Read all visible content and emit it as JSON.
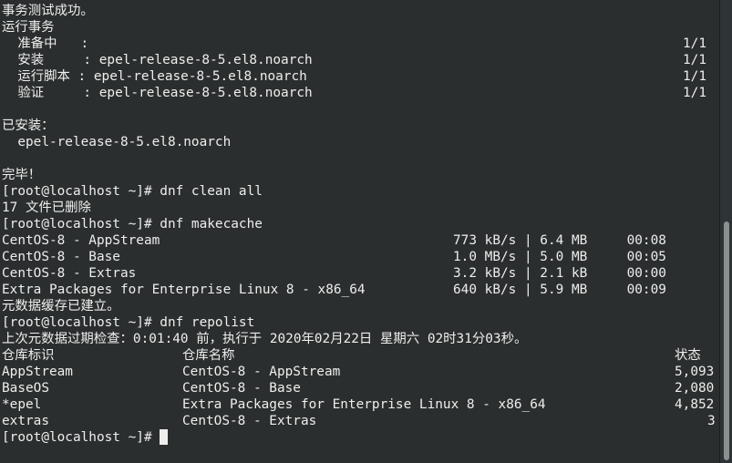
{
  "lines": [
    {
      "segments": [
        {
          "text": "事务测试成功。",
          "col": 0
        }
      ]
    },
    {
      "segments": [
        {
          "text": "运行事务",
          "col": 0
        }
      ]
    },
    {
      "segments": [
        {
          "text": "  准备中   :",
          "col": 0
        },
        {
          "text": "1/1",
          "col": 83
        }
      ]
    },
    {
      "segments": [
        {
          "text": "  安装     : epel-release-8-5.el8.noarch",
          "col": 0
        },
        {
          "text": "1/1",
          "col": 83
        }
      ]
    },
    {
      "segments": [
        {
          "text": "  运行脚本 : epel-release-8-5.el8.noarch",
          "col": 0
        },
        {
          "text": "1/1",
          "col": 83
        }
      ]
    },
    {
      "segments": [
        {
          "text": "  验证     : epel-release-8-5.el8.noarch",
          "col": 0
        },
        {
          "text": "1/1",
          "col": 83
        }
      ]
    },
    {
      "segments": []
    },
    {
      "segments": [
        {
          "text": "已安装：",
          "col": 0
        }
      ]
    },
    {
      "segments": [
        {
          "text": "  epel-release-8-5.el8.noarch",
          "col": 0
        }
      ]
    },
    {
      "segments": []
    },
    {
      "segments": [
        {
          "text": "完毕！",
          "col": 0
        }
      ]
    },
    {
      "segments": [
        {
          "text": "[root@localhost ~]# dnf clean all",
          "col": 0
        }
      ]
    },
    {
      "segments": [
        {
          "text": "17 文件已删除",
          "col": 0
        }
      ]
    },
    {
      "segments": [
        {
          "text": "[root@localhost ~]# dnf makecache",
          "col": 0
        }
      ]
    },
    {
      "segments": [
        {
          "text": "CentOS-8 - AppStream",
          "col": 0
        },
        {
          "text": "773 kB/s | 6.4 MB     00:08",
          "col": 55
        }
      ]
    },
    {
      "segments": [
        {
          "text": "CentOS-8 - Base",
          "col": 0
        },
        {
          "text": "1.0 MB/s | 5.0 MB     00:05",
          "col": 55
        }
      ]
    },
    {
      "segments": [
        {
          "text": "CentOS-8 - Extras",
          "col": 0
        },
        {
          "text": "3.2 kB/s | 2.1 kB     00:00",
          "col": 55
        }
      ]
    },
    {
      "segments": [
        {
          "text": "Extra Packages for Enterprise Linux 8 - x86_64",
          "col": 0
        },
        {
          "text": "640 kB/s | 5.9 MB     00:09",
          "col": 55
        }
      ]
    },
    {
      "segments": [
        {
          "text": "元数据缓存已建立。",
          "col": 0
        }
      ]
    },
    {
      "segments": [
        {
          "text": "[root@localhost ~]# dnf repolist",
          "col": 0
        }
      ]
    },
    {
      "segments": [
        {
          "text": "上次元数据过期检查：0:01:40 前，执行于 2020年02月22日 星期六 02时31分03秒。",
          "col": 0
        }
      ]
    },
    {
      "segments": [
        {
          "text": "仓库标识",
          "col": 0
        },
        {
          "text": "仓库名称",
          "col": 22
        },
        {
          "text": "状态",
          "col": 82
        }
      ]
    },
    {
      "segments": [
        {
          "text": "AppStream",
          "col": 0
        },
        {
          "text": "CentOS-8 - AppStream",
          "col": 22
        },
        {
          "text": "5,093",
          "col": 82
        }
      ]
    },
    {
      "segments": [
        {
          "text": "BaseOS",
          "col": 0
        },
        {
          "text": "CentOS-8 - Base",
          "col": 22
        },
        {
          "text": "2,080",
          "col": 82
        }
      ]
    },
    {
      "segments": [
        {
          "text": "*epel",
          "col": 0
        },
        {
          "text": "Extra Packages for Enterprise Linux 8 - x86_64",
          "col": 22
        },
        {
          "text": "4,852",
          "col": 82
        }
      ]
    },
    {
      "segments": [
        {
          "text": "extras",
          "col": 0
        },
        {
          "text": "CentOS-8 - Extras",
          "col": 22
        },
        {
          "text": "3",
          "col": 86
        }
      ]
    },
    {
      "segments": [
        {
          "text": "[root@localhost ~]#",
          "col": 0
        }
      ],
      "cursor": true
    }
  ]
}
